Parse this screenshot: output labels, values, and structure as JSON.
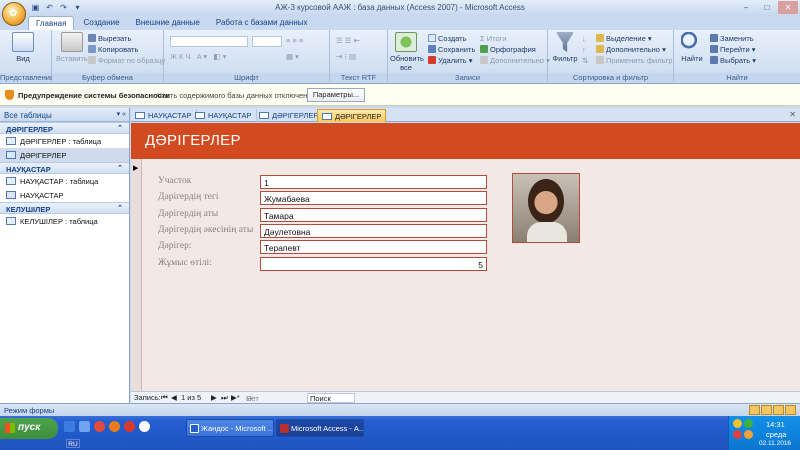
{
  "window": {
    "title": "АЖ-3 курсовой ААЖ : база данных (Access 2007) - Microsoft Access",
    "controls": [
      "–",
      "□",
      "✕"
    ]
  },
  "ribbon_tabs": [
    "Главная",
    "Создание",
    "Внешние данные",
    "Работа с базами данных"
  ],
  "ribbon": {
    "views": {
      "label": "Вид",
      "group": "Представления"
    },
    "clipboard": {
      "paste": "Вставить",
      "cut": "Вырезать",
      "copy": "Копировать",
      "format_painter": "Формат по образцу",
      "group": "Буфер обмена"
    },
    "font": {
      "group": "Шрифт"
    },
    "rich_text": {
      "group": "Текст RTF"
    },
    "records": {
      "refresh": "Обновить все",
      "new": "Создать",
      "save": "Сохранить",
      "delete": "Удалить",
      "totals": "Итоги",
      "spelling": "Орфография",
      "more": "Дополнительно",
      "group": "Записи"
    },
    "sort_filter": {
      "filter": "Фильтр",
      "selection": "Выделение",
      "advanced": "Дополнительно",
      "toggle": "Применить фильтр",
      "group": "Сортировка и фильтр"
    },
    "find": {
      "find": "Найти",
      "replace": "Заменить",
      "goto": "Перейти",
      "select": "Выбрать",
      "group": "Найти"
    }
  },
  "security_bar": {
    "title": "Предупреждение системы безопасности",
    "message": "Часть содержимого базы данных отключено",
    "options_button": "Параметры..."
  },
  "nav_pane": {
    "header": "Все таблицы",
    "groups": [
      {
        "name": "ДӘРІГЕРЛЕР",
        "items": [
          {
            "label": "ДӘРІГЕРЛЕР : таблица",
            "kind": "table"
          },
          {
            "label": "ДӘРІГЕРЛЕР",
            "kind": "form",
            "selected": true
          }
        ]
      },
      {
        "name": "НАУҚАСТАР",
        "items": [
          {
            "label": "НАУҚАСТАР : таблица",
            "kind": "table"
          },
          {
            "label": "НАУҚАСТАР",
            "kind": "form"
          }
        ]
      },
      {
        "name": "КЕЛУШІЛЕР",
        "items": [
          {
            "label": "КЕЛУШІЛЕР : таблица",
            "kind": "table"
          }
        ]
      }
    ]
  },
  "doc_tabs": [
    "НАУҚАСТАР",
    "НАУҚАСТАР",
    "ДӘРІГЕРЛЕР",
    "ДӘРІГЕРЛЕР"
  ],
  "form": {
    "title": "ДӘРІГЕРЛЕР",
    "fields": [
      {
        "label": "Участок",
        "value": "1"
      },
      {
        "label": "Дәрігердің тегі",
        "value": "Жумабаева"
      },
      {
        "label": "Дәрігердің аты",
        "value": "Тамара"
      },
      {
        "label": "Дәрігердің әкесінің аты",
        "value": "Дәулетовна"
      },
      {
        "label": "Дәрігер:",
        "value": "Терапевт"
      },
      {
        "label": "Жұмыс өтілі:",
        "value": "5"
      }
    ]
  },
  "record_nav": {
    "label": "Запись:",
    "position": "1 из 5",
    "filter": "Нет фильтра",
    "search": "Поиск"
  },
  "status": "Режим формы",
  "taskbar": {
    "start": "пуск",
    "items": [
      "Жандос - Microsoft ...",
      "Microsoft Access - А..."
    ],
    "lang": "RU",
    "time": "14:31",
    "day": "среда",
    "date": "02.11.2016"
  }
}
